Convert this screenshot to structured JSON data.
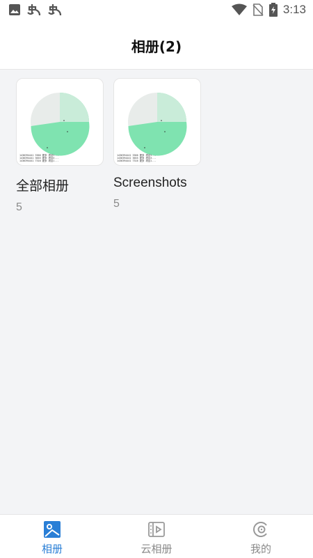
{
  "status_bar": {
    "time": "3:13",
    "icons_left": [
      "image-icon",
      "bug-icon",
      "bug-icon"
    ],
    "icons_right": [
      "wifi-icon",
      "no-sim-icon",
      "battery-charging-icon"
    ]
  },
  "header": {
    "title": "相册(2)"
  },
  "albums": [
    {
      "name": "全部相册",
      "count": "5",
      "thumb_text": "1436394441 3366 更多 项目t...\n1436394441 3655 更多 项目3...\n1436394441 7316 更多 项目1..."
    },
    {
      "name": "Screenshots",
      "count": "5",
      "thumb_text": "1436394441 3366 更多 项目t...\n1436394441 3655 更多 项目3...\n1436394441 7316 更多 项目1..."
    }
  ],
  "bottom_nav": {
    "items": [
      {
        "label": "相册",
        "icon": "photo-album-icon",
        "active": true
      },
      {
        "label": "云相册",
        "icon": "cloud-album-icon",
        "active": false
      },
      {
        "label": "我的",
        "icon": "profile-icon",
        "active": false
      }
    ]
  },
  "colors": {
    "accent": "#2a7fd6",
    "background": "#f3f4f6",
    "pie_green": "#7fe3b0",
    "pie_gray": "#e8ecea"
  }
}
